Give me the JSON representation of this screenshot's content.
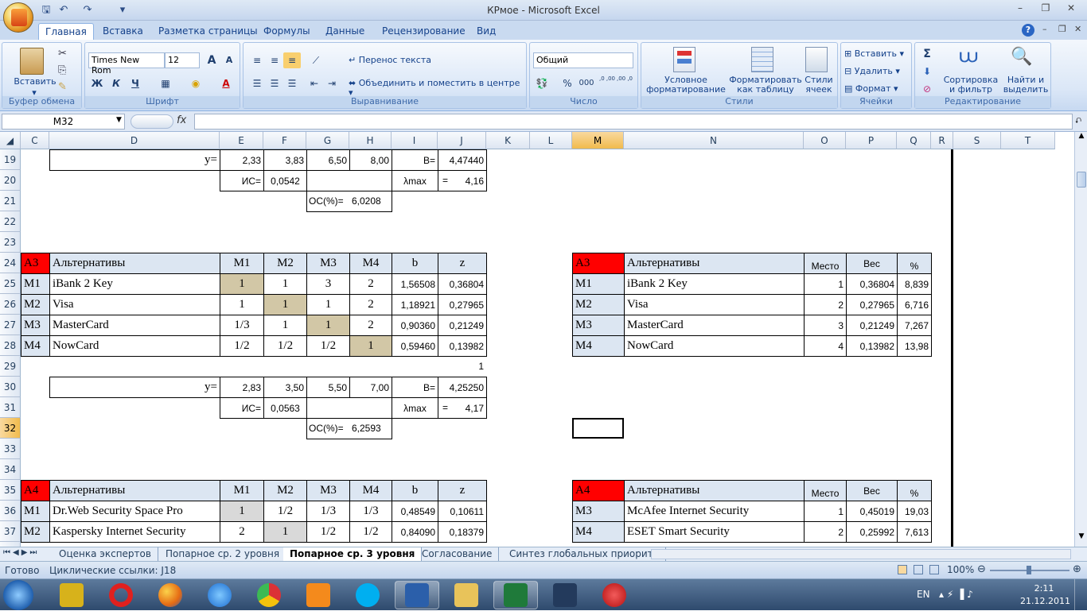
{
  "window": {
    "title": "КРмое - Microsoft Excel"
  },
  "tabs": [
    "Главная",
    "Вставка",
    "Разметка страницы",
    "Формулы",
    "Данные",
    "Рецензирование",
    "Вид"
  ],
  "ribbon": {
    "clipboard": {
      "paste": "Вставить",
      "label": "Буфер обмена"
    },
    "font": {
      "name": "Times New Rom",
      "size": "12",
      "bold": "Ж",
      "italic": "К",
      "underline": "Ч",
      "label": "Шрифт",
      "grow": "A",
      "shrink": "A"
    },
    "alignment": {
      "wrap": "Перенос текста",
      "merge": "Объединить и поместить в центре",
      "label": "Выравнивание"
    },
    "number": {
      "format": "Общий",
      "percent": "%",
      "thousands": "000",
      "inc": ",0 ,00",
      "dec": ",00 ,0",
      "label": "Число"
    },
    "styles": {
      "cond": "Условное форматирование",
      "cond1": "Условное",
      "cond2": "форматирование",
      "table1": "Форматировать",
      "table2": "как таблицу",
      "cell1": "Стили",
      "cell2": "ячеек",
      "label": "Стили"
    },
    "cells": {
      "insert": "Вставить",
      "delete": "Удалить",
      "format": "Формат",
      "label": "Ячейки"
    },
    "editing": {
      "sum": "Σ",
      "sort1": "Сортировка",
      "sort2": "и фильтр",
      "find1": "Найти и",
      "find2": "выделить",
      "label": "Редактирование"
    }
  },
  "formula_bar": {
    "name_box": "M32",
    "fx": "fx",
    "value": ""
  },
  "columns": [
    "C",
    "D",
    "E",
    "F",
    "G",
    "H",
    "I",
    "J",
    "K",
    "L",
    "M",
    "N",
    "O",
    "P",
    "Q",
    "R",
    "S",
    "T"
  ],
  "rows": [
    "19",
    "20",
    "21",
    "22",
    "23",
    "24",
    "25",
    "26",
    "27",
    "28",
    "29",
    "30",
    "31",
    "32",
    "33",
    "34",
    "35",
    "36",
    "37",
    "38"
  ],
  "cells": {
    "r19": {
      "y_label": "y=",
      "e": "2,33",
      "f": "3,83",
      "g": "6,50",
      "h": "8,00",
      "i": "B=",
      "j": "4,47440"
    },
    "r20": {
      "is_label": "ИС=",
      "is_val": "0,0542",
      "lambda": "λmax",
      "eq": "=",
      "lambda_val": "4,16"
    },
    "r21": {
      "os_label": "ОС(%)=",
      "os_val": "6,0208"
    },
    "t3": {
      "hdr": {
        "id": "A3",
        "title": "Альтернативы",
        "m1": "M1",
        "m2": "M2",
        "m3": "M3",
        "m4": "M4",
        "b": "b",
        "z": "z"
      },
      "rows": [
        {
          "id": "M1",
          "name": "iBank 2 Key",
          "v": [
            "1",
            "1",
            "3",
            "2"
          ],
          "b": "1,56508",
          "z": "0,36804"
        },
        {
          "id": "M2",
          "name": "Visa",
          "v": [
            "1",
            "1",
            "1",
            "2"
          ],
          "b": "1,18921",
          "z": "0,27965"
        },
        {
          "id": "M3",
          "name": "MasterCard",
          "v": [
            "1/3",
            "1",
            "1",
            "2"
          ],
          "b": "0,90360",
          "z": "0,21249"
        },
        {
          "id": "M4",
          "name": "NowCard",
          "v": [
            "1/2",
            "1/2",
            "1/2",
            "1"
          ],
          "b": "0,59460",
          "z": "0,13982"
        }
      ],
      "rank_hdr": {
        "id": "A3",
        "title": "Альтернативы",
        "place": "Место",
        "weight": "Вес",
        "pct": "%"
      },
      "rank": [
        {
          "id": "M1",
          "name": "iBank 2 Key",
          "place": "1",
          "w": "0,36804",
          "p": "8,839"
        },
        {
          "id": "M2",
          "name": "Visa",
          "place": "2",
          "w": "0,27965",
          "p": "6,716"
        },
        {
          "id": "M3",
          "name": "MasterCard",
          "place": "3",
          "w": "0,21249",
          "p": "7,267"
        },
        {
          "id": "M4",
          "name": "NowCard",
          "place": "4",
          "w": "0,13982",
          "p": "13,98"
        }
      ]
    },
    "r29": {
      "j": "1"
    },
    "r30": {
      "y_label": "y=",
      "e": "2,83",
      "f": "3,50",
      "g": "5,50",
      "h": "7,00",
      "i": "B=",
      "j": "4,25250"
    },
    "r31": {
      "is_label": "ИС=",
      "is_val": "0,0563",
      "lambda": "λmax",
      "eq": "=",
      "lambda_val": "4,17"
    },
    "r32": {
      "os_label": "ОС(%)=",
      "os_val": "6,2593"
    },
    "t4": {
      "hdr": {
        "id": "A4",
        "title": "Альтернативы",
        "m1": "M1",
        "m2": "M2",
        "m3": "M3",
        "m4": "M4",
        "b": "b",
        "z": "z"
      },
      "rows": [
        {
          "id": "M1",
          "name": "Dr.Web Security Space Pro",
          "v": [
            "1",
            "1/2",
            "1/3",
            "1/3"
          ],
          "b": "0,48549",
          "z": "0,10611"
        },
        {
          "id": "M2",
          "name": "Kaspersky Internet Security",
          "v": [
            "2",
            "1",
            "1/2",
            "1/2"
          ],
          "b": "0,84090",
          "z": "0,18379"
        }
      ],
      "rank_hdr": {
        "id": "A4",
        "title": "Альтернативы",
        "place": "Место",
        "weight": "Вес",
        "pct": "%"
      },
      "rank": [
        {
          "id": "M3",
          "name": "McAfee Internet Security",
          "place": "1",
          "w": "0,45019",
          "p": "19,03"
        },
        {
          "id": "M4",
          "name": "ESET Smart Security",
          "place": "2",
          "w": "0,25992",
          "p": "7,613"
        }
      ]
    }
  },
  "sheet_tabs": [
    "Оценка экспертов",
    "Попарное ср. 2 уровня",
    "Попарное ср. 3 уровня",
    "Согласование",
    "Синтез глобальных приорите"
  ],
  "status": {
    "ready": "Готово",
    "circular": "Циклические ссылки: J18",
    "zoom": "100%"
  },
  "taskbar": {
    "lang": "EN",
    "time": "2:11",
    "date": "21.12.2011"
  }
}
